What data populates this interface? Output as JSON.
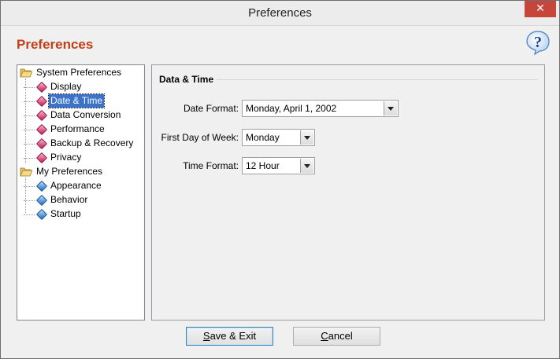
{
  "window": {
    "title": "Preferences",
    "close_glyph": "✕"
  },
  "header": {
    "title": "Preferences",
    "help_icon": "help-question-icon"
  },
  "tree": {
    "groups": [
      {
        "label": "System Preferences",
        "icon": "folder-open-icon",
        "items": [
          "Display",
          "Date & Time",
          "Data Conversion",
          "Performance",
          "Backup & Recovery",
          "Privacy"
        ]
      },
      {
        "label": "My Preferences",
        "icon": "folder-open-icon",
        "items": [
          "Appearance",
          "Behavior",
          "Startup"
        ]
      }
    ],
    "selected": "Date & Time"
  },
  "panel": {
    "title": "Data & Time",
    "date_format_label": "Date Format:",
    "date_format_value": "Monday, April 1, 2002",
    "first_day_label": "First Day of Week:",
    "first_day_value": "Monday",
    "time_format_label": "Time Format:",
    "time_format_value": "12 Hour"
  },
  "buttons": {
    "save_pre": "",
    "save_key": "S",
    "save_rest": "ave & Exit",
    "cancel_key": "C",
    "cancel_rest": "ancel"
  },
  "colors": {
    "header_title": "#c0401a",
    "selection": "#3a73c8",
    "close": "#c7463b"
  }
}
